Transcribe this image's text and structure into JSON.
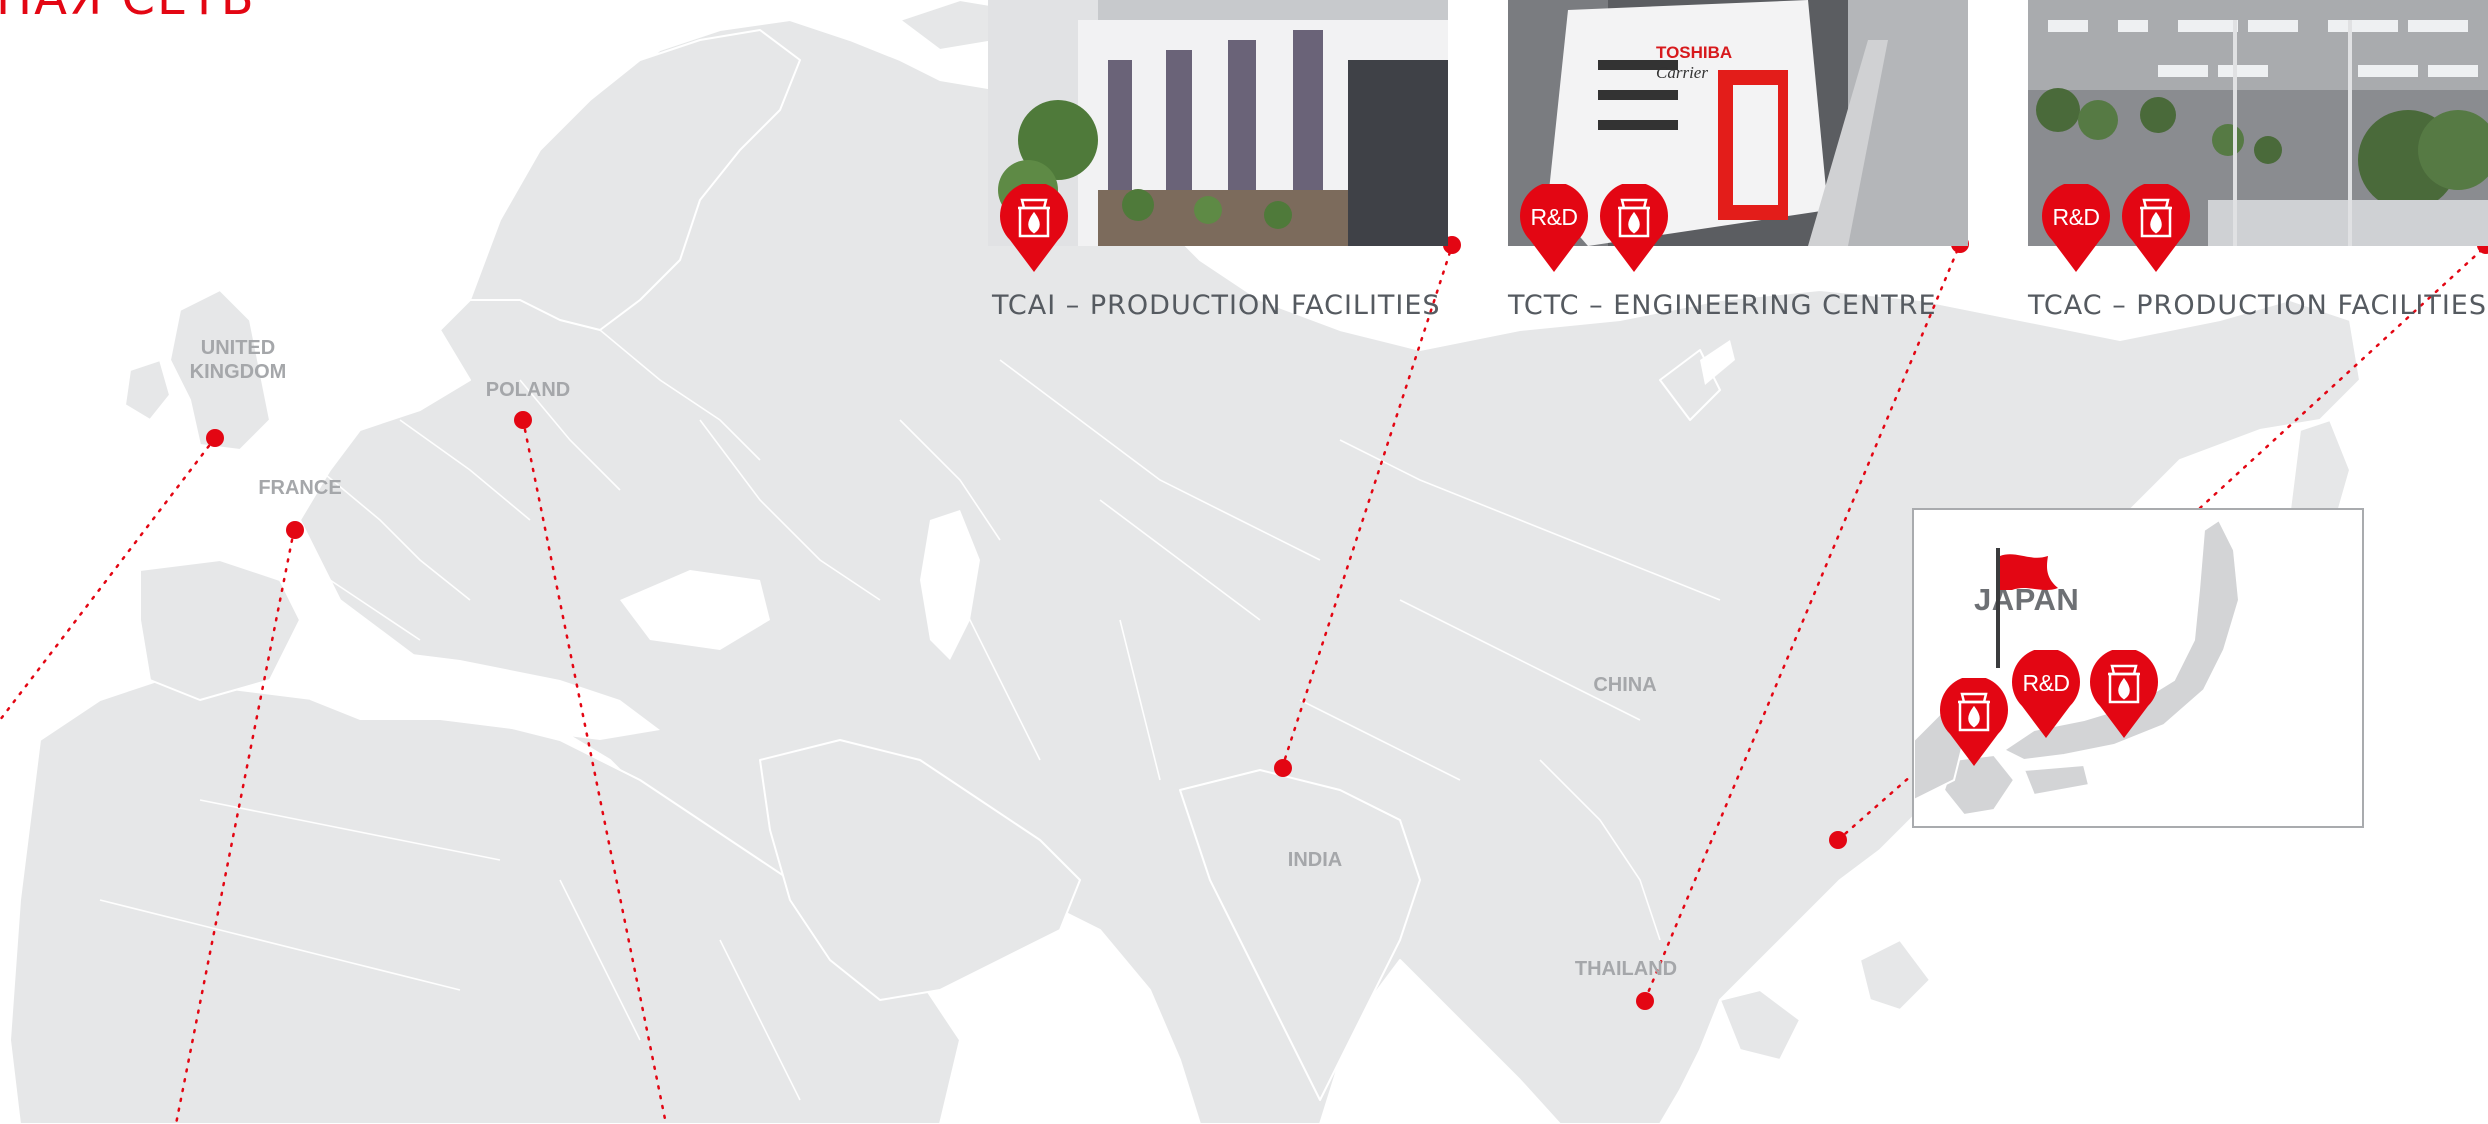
{
  "page": {
    "heading": "НАЯ СЕТЬ",
    "accent_color": "#e30613",
    "land_color": "#e6e7e8",
    "border_color": "#ffffff"
  },
  "facilities": [
    {
      "caption": "TCAI – PRODUCTION FACILITIES",
      "pins": [
        "factory-icon"
      ]
    },
    {
      "caption": "TCTC – ENGINEERING CENTRE",
      "pins": [
        "R&D",
        "factory-icon"
      ]
    },
    {
      "caption": "TCAC – PRODUCTION FACILITIES",
      "pins": [
        "R&D",
        "factory-icon"
      ]
    }
  ],
  "countries": {
    "uk": "UNITED\nKINGDOM",
    "france": "FRANCE",
    "poland": "POLAND",
    "china": "CHINA",
    "india": "INDIA",
    "thailand": "THAILAND"
  },
  "photo_signage": {
    "tctc_brand_1": "TOSHIBA",
    "tctc_brand_2": "Carrier"
  },
  "japan_inset": {
    "title": "JAPAN",
    "pins": [
      "factory-icon",
      "R&D",
      "factory-icon"
    ],
    "flag_icon": "flag-icon"
  },
  "rd_label": "R&D"
}
